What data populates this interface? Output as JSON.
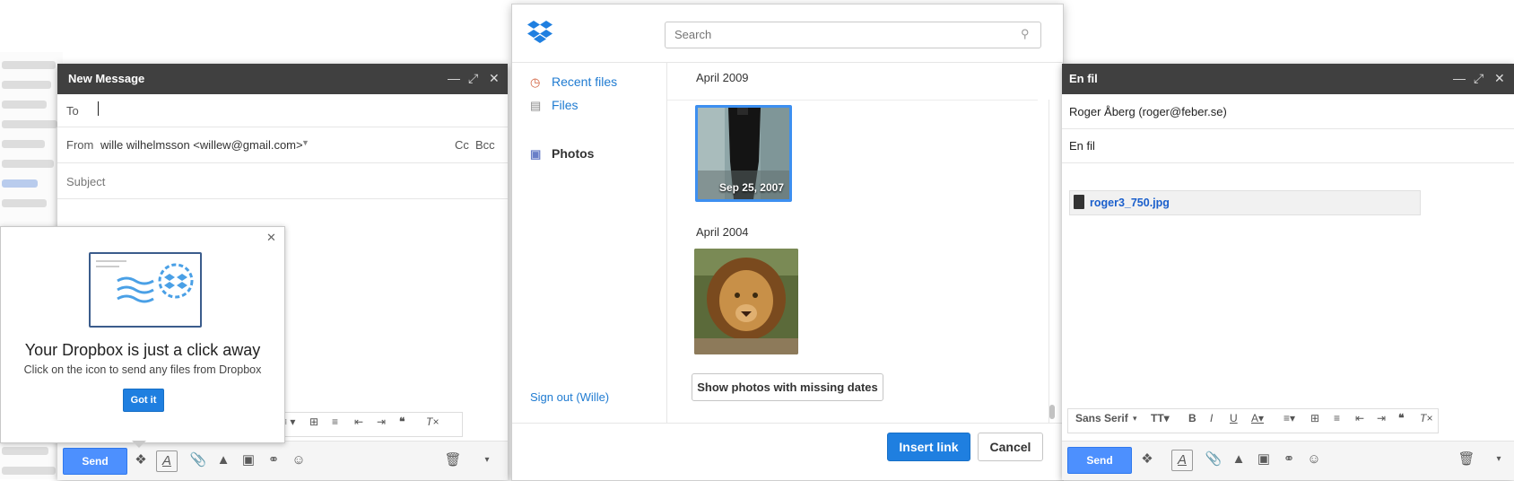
{
  "left_compose": {
    "title": "New Message",
    "to_label": "To",
    "from_label": "From",
    "from_value": "wille wilhelmsson <willew@gmail.com>",
    "cc_label": "Cc",
    "bcc_label": "Bcc",
    "subject_placeholder": "Subject",
    "send_label": "Send"
  },
  "popup": {
    "headline": "Your Dropbox is just a click away",
    "body": "Click on the icon to send any files from Dropbox",
    "button": "Got it"
  },
  "chooser": {
    "search_placeholder": "Search",
    "nav": [
      {
        "label": "Recent files",
        "icon": "clock-icon"
      },
      {
        "label": "Files",
        "icon": "file-icon"
      },
      {
        "label": "Photos",
        "icon": "photos-icon"
      }
    ],
    "sign_out": "Sign out (Wille)",
    "groups": [
      {
        "heading": "April 2009",
        "photo_caption": "Sep 25, 2007"
      },
      {
        "heading": "April 2004",
        "photo_caption": ""
      }
    ],
    "show_missing": "Show photos with missing dates",
    "insert": "Insert link",
    "cancel": "Cancel"
  },
  "right_compose": {
    "title": "En fil",
    "to_value": "Roger Åberg (roger@feber.se)",
    "subject_value": "En fil",
    "attachment": "roger3_750.jpg",
    "font_label": "Sans Serif",
    "send_label": "Send"
  },
  "colors": {
    "titlebar": "#404040",
    "send_blue": "#4d90fe",
    "dropbox_blue": "#1f7fe0"
  }
}
